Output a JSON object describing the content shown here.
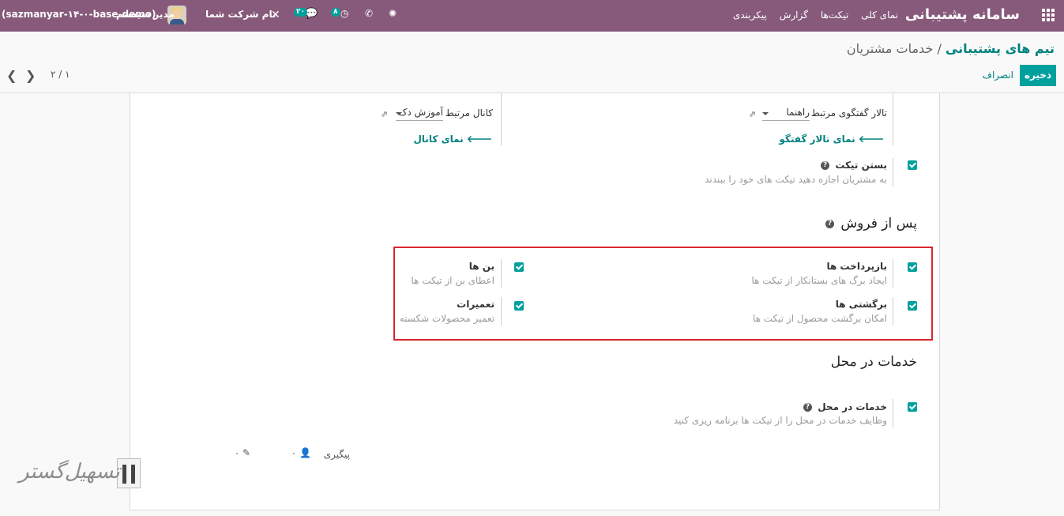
{
  "navbar": {
    "brand": "سامانه پشتیبانی",
    "menu": [
      "نمای کلی",
      "تیکت‌ها",
      "گزارش",
      "پیکربندی"
    ],
    "company": "نام شرکت شما",
    "user": "مدیر سیستم",
    "db": "(sazmanyar-۱۴-۰-base-demo)",
    "activity_count": "۸",
    "message_count": "۲۰",
    "accent": "#875a7b"
  },
  "breadcrumb": {
    "parent": "تیم های پشتیبانی",
    "separator": "/",
    "current": "خدمات مشتریان"
  },
  "actions": {
    "save": "ذخیره",
    "discard": "انصراف"
  },
  "pager": {
    "value": "۲ / ۱"
  },
  "top_fields": {
    "forum_label": "تالار گفتگوی مرتبط",
    "forum_value": "راهنما",
    "forum_view": "نمای تالار گفتگو",
    "channel_label": "کانال مرتبط",
    "channel_value": "آموزش دک",
    "channel_view": "نمای کانال"
  },
  "close_ticket": {
    "title": "بستن تیکت",
    "desc": "به مشتریان اجازه دهید تیکت های خود را ببندند",
    "checked": true
  },
  "after_sales": {
    "title": "پس از فروش",
    "items": [
      {
        "title": "بازپرداخت ها",
        "desc": "ایجاد برگ های بستانکار از تیکت ها",
        "checked": true
      },
      {
        "title": "بن ها",
        "desc": "اعطای بن از تیکت ها",
        "checked": true
      },
      {
        "title": "برگشتی ها",
        "desc": "امکان برگشت محصول از تیکت ها",
        "checked": true
      },
      {
        "title": "تعمیرات",
        "desc": "تعمیر محصولات شکسته",
        "checked": true
      }
    ]
  },
  "onsite": {
    "title": "خدمات در محل",
    "item": {
      "title": "خدمات در محل",
      "desc": "وظایف خدمات در محل را از تیکت ها برنامه ریزی کنید",
      "checked": true
    }
  },
  "chatter": {
    "follow": "پیگیری",
    "followers": "۰",
    "attachments": "۰"
  },
  "watermark": {
    "text": "تسهیل‌گستر"
  }
}
